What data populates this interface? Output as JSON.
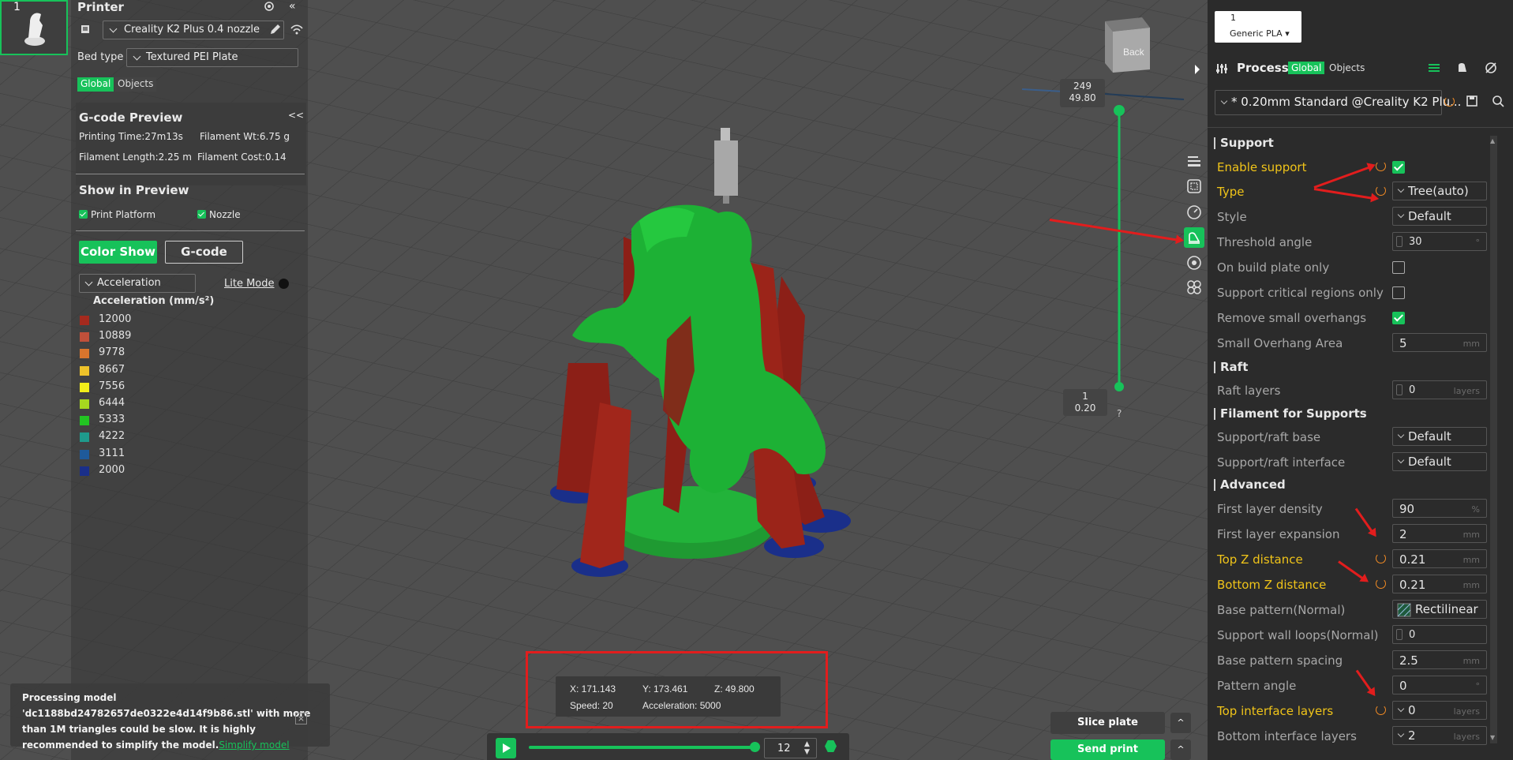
{
  "app": {
    "accent": "#17c25a",
    "warn": "#f0c419"
  },
  "printer": {
    "section_title": "Printer",
    "plate_index": "1",
    "printer_name": "Creality K2 Plus 0.4 nozzle",
    "bed_type_label": "Bed type",
    "bed_type_value": "Textured PEI Plate",
    "tab_global": "Global",
    "tab_objects": "Objects"
  },
  "gcode_preview": {
    "title": "G-code Preview",
    "collapse_glyph": "<<",
    "printing_time": "Printing Time:27m13s",
    "filament_wt": "Filament Wt:6.75 g",
    "filament_length": "Filament Length:2.25 m",
    "filament_cost": "Filament Cost:0.14",
    "show_in_preview": "Show in Preview",
    "print_platform": "Print Platform",
    "nozzle": "Nozzle",
    "color_show_btn": "Color Show",
    "gcode_btn": "G-code",
    "view_type": "Acceleration",
    "lite_mode": "Lite Mode",
    "legend_title": "Acceleration (mm/s²)",
    "legend": [
      {
        "value": "12000",
        "color": "#a52a1e"
      },
      {
        "value": "10889",
        "color": "#c0503a"
      },
      {
        "value": "9778",
        "color": "#d9752d"
      },
      {
        "value": "8667",
        "color": "#eec22a"
      },
      {
        "value": "7556",
        "color": "#f2ee1a"
      },
      {
        "value": "6444",
        "color": "#a6d81f"
      },
      {
        "value": "5333",
        "color": "#22c322"
      },
      {
        "value": "4222",
        "color": "#1f9a8c"
      },
      {
        "value": "3111",
        "color": "#1f5a9a"
      },
      {
        "value": "2000",
        "color": "#1a2f8a"
      }
    ]
  },
  "viewport": {
    "view_cube": "Back",
    "layer_top_num": "249",
    "layer_top_height": "49.80",
    "layer_bottom_num": "1",
    "layer_bottom_height": "0.20",
    "help_glyph": "?",
    "tooltip": {
      "x": "X: 171.143",
      "y": "Y: 173.461",
      "z": "Z: 49.800",
      "speed": "Speed: 20",
      "accel": "Acceleration: 5000"
    },
    "move_value": "12",
    "notification": "Processing model 'dc1188bd24782657de0322e4d14f9b86.stl' with more than 1M triangles could be slow. It is highly recommended to simplify the model.",
    "notification_link": "Simplify model",
    "slice_btn": "Slice plate",
    "send_btn": "Send print"
  },
  "process": {
    "filament_num": "1",
    "filament_name": "Generic PLA ▾",
    "title": "Process",
    "tab_global": "Global",
    "tab_objects": "Objects",
    "preset": "* 0.20mm Standard @Creality K2 Plu..."
  },
  "settings": {
    "support_title": "Support",
    "enable_support": "Enable support",
    "type_label": "Type",
    "type_value": "Tree(auto)",
    "style_label": "Style",
    "style_value": "Default",
    "threshold_label": "Threshold angle",
    "threshold_value": "30",
    "threshold_unit": "°",
    "on_build_plate": "On build plate only",
    "critical_regions": "Support critical regions only",
    "remove_small": "Remove small overhangs",
    "small_area_label": "Small Overhang Area",
    "small_area_value": "5",
    "small_area_unit": "mm",
    "raft_title": "Raft",
    "raft_layers_label": "Raft layers",
    "raft_layers_value": "0",
    "raft_layers_unit": "layers",
    "filament_supports_title": "Filament for Supports",
    "raft_base_label": "Support/raft base",
    "raft_base_value": "Default",
    "raft_interface_label": "Support/raft interface",
    "raft_interface_value": "Default",
    "advanced_title": "Advanced",
    "first_density_label": "First layer density",
    "first_density_value": "90",
    "first_density_unit": "%",
    "first_expansion_label": "First layer expansion",
    "first_expansion_value": "2",
    "first_expansion_unit": "mm",
    "top_z_label": "Top Z distance",
    "top_z_value": "0.21",
    "top_z_unit": "mm",
    "bottom_z_label": "Bottom Z distance",
    "bottom_z_value": "0.21",
    "bottom_z_unit": "mm",
    "base_pattern_label": "Base pattern(Normal)",
    "base_pattern_value": "Rectilinear",
    "wall_loops_label": "Support wall loops(Normal)",
    "wall_loops_value": "0",
    "pattern_spacing_label": "Base pattern spacing",
    "pattern_spacing_value": "2.5",
    "pattern_spacing_unit": "mm",
    "pattern_angle_label": "Pattern angle",
    "pattern_angle_value": "0",
    "pattern_angle_unit": "°",
    "top_interface_label": "Top interface layers",
    "top_interface_value": "0",
    "top_interface_unit": "layers",
    "bottom_interface_label": "Bottom interface layers",
    "bottom_interface_value": "2",
    "bottom_interface_unit": "layers"
  }
}
